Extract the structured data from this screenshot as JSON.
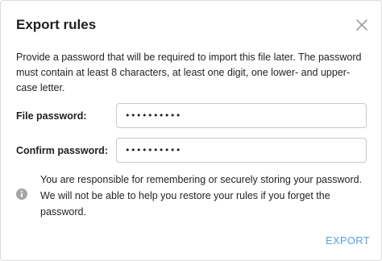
{
  "dialog": {
    "title": "Export rules",
    "description": "Provide a password that will be required to import this file later. The password must contain at least 8 characters, at least one digit, one lower- and upper-case letter.",
    "fields": {
      "file_password": {
        "label": "File password:",
        "value": "••••••••••"
      },
      "confirm_password": {
        "label": "Confirm password:",
        "value": "••••••••••"
      }
    },
    "info": {
      "icon": "info-icon",
      "text": "You are responsible for remembering or securely storing your password. We will not be able to help you restore your rules if you forget the password."
    },
    "actions": {
      "export_label": "EXPORT",
      "close_icon": "close-icon"
    }
  },
  "colors": {
    "accent": "#5a9fde",
    "text": "#232323",
    "border": "#c8c8c8",
    "icon": "#9e9e9e"
  }
}
